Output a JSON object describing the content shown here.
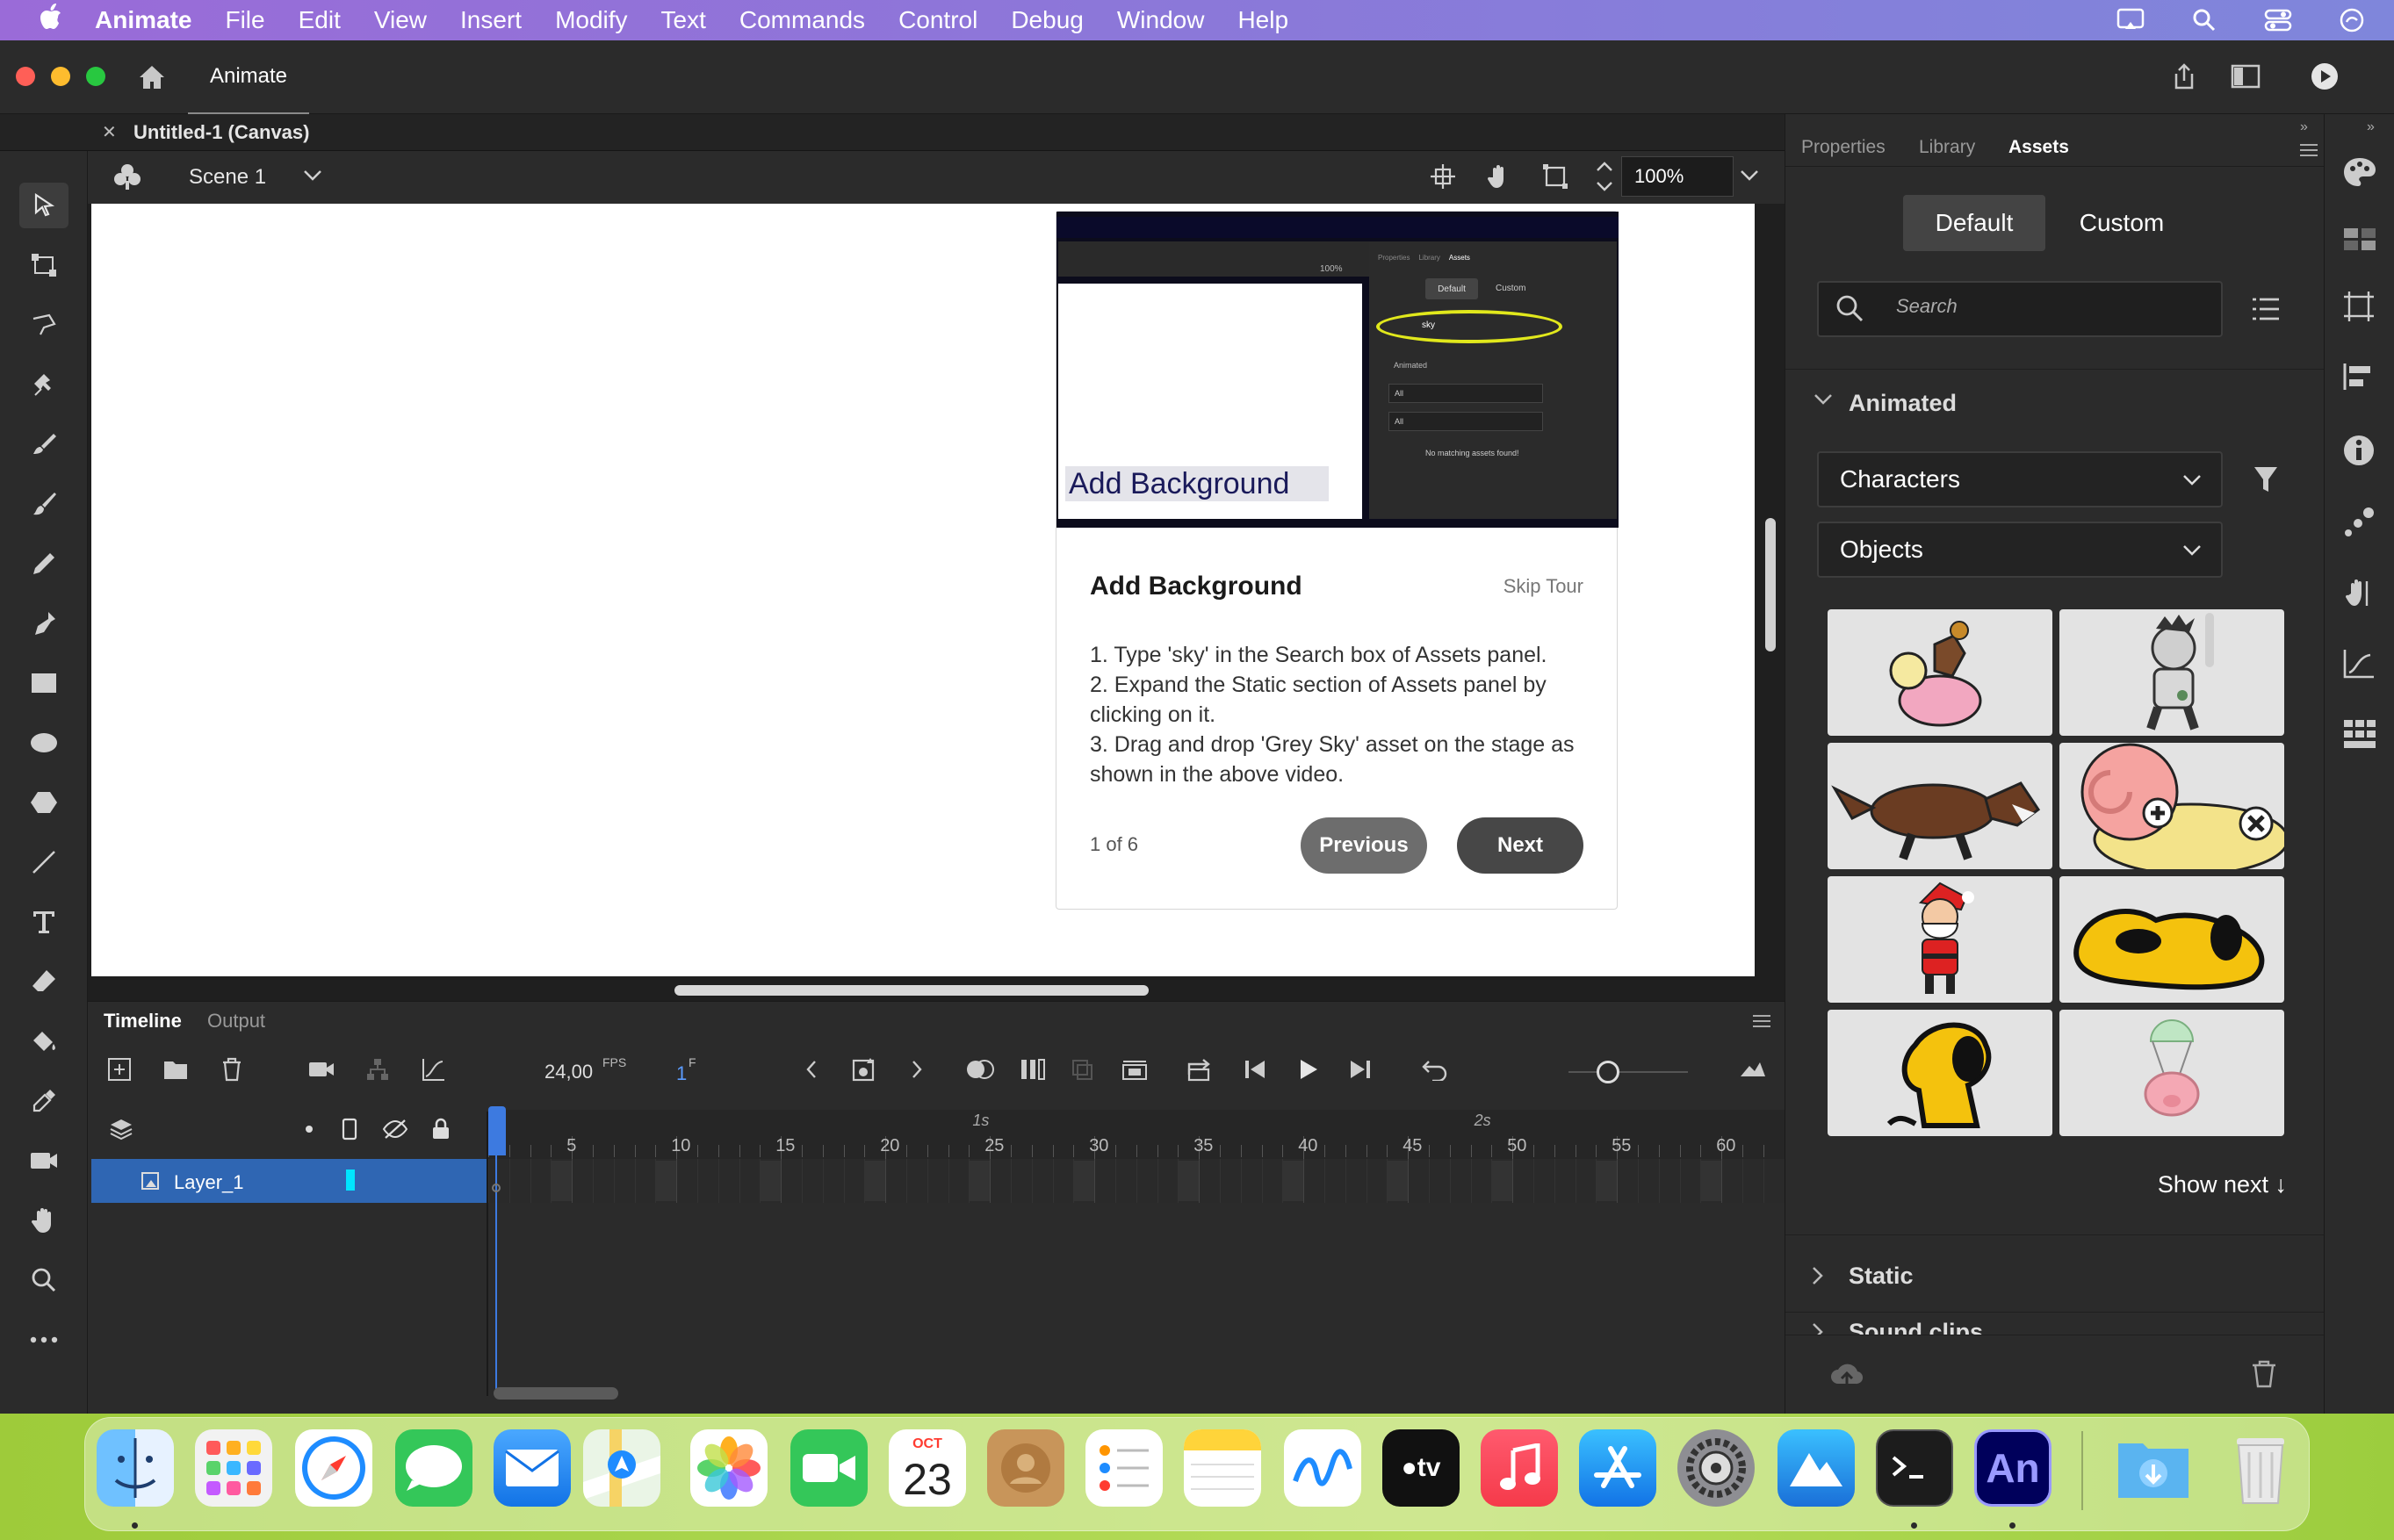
{
  "menubar": {
    "app_name": "Animate",
    "items": [
      "File",
      "Edit",
      "View",
      "Insert",
      "Modify",
      "Text",
      "Commands",
      "Control",
      "Debug",
      "Window",
      "Help"
    ]
  },
  "apptop": {
    "home_tab": "Animate"
  },
  "document": {
    "tab_title": "Untitled-1 (Canvas)",
    "scene": "Scene 1",
    "zoom": "100%"
  },
  "tour": {
    "thumb_label": "Add Background",
    "thumb_tabs": [
      "Properties",
      "Library",
      "Assets"
    ],
    "thumb_default": "Default",
    "thumb_custom": "Custom",
    "thumb_search": "sky",
    "thumb_animated": "Animated",
    "thumb_all1": "All",
    "thumb_all2": "All",
    "thumb_zoom": "100%",
    "thumb_nomatch": "No matching assets found!",
    "title": "Add Background",
    "skip": "Skip Tour",
    "steps": [
      "1. Type 'sky' in the Search box of Assets panel.",
      "2. Expand the Static section of Assets panel by clicking on it.",
      "3. Drag and drop 'Grey Sky' asset on the stage as shown in the above video."
    ],
    "counter": "1 of 6",
    "previous": "Previous",
    "next": "Next"
  },
  "timeline": {
    "tabs": [
      "Timeline",
      "Output"
    ],
    "fps_value": "24,00",
    "fps_unit": "FPS",
    "frame_value": "1",
    "frame_unit": "F",
    "layer_name": "Layer_1",
    "ruler_numbers": [
      "5",
      "10",
      "15",
      "20",
      "25",
      "30",
      "35",
      "40",
      "45",
      "50",
      "55",
      "60"
    ],
    "seconds": [
      "1s",
      "2s"
    ]
  },
  "rightpanel": {
    "tabs": [
      "Properties",
      "Library",
      "Assets"
    ],
    "active_tab": "Assets",
    "toggle_default": "Default",
    "toggle_custom": "Custom",
    "search_placeholder": "Search",
    "section_animated": "Animated",
    "dropdown1": "Characters",
    "dropdown2": "Objects",
    "show_next": "Show next ↓",
    "section_static": "Static",
    "section_sound": "Sound clips"
  },
  "dock": {
    "calendar_month": "OCT",
    "calendar_day": "23",
    "animate_label": "An",
    "tv_label": "tv"
  },
  "colors": {
    "accent_blue": "#3a7bd5",
    "selection_blue": "#2f66b3",
    "playhead": "#3d7ae0",
    "menubar": "#8b78d9"
  }
}
